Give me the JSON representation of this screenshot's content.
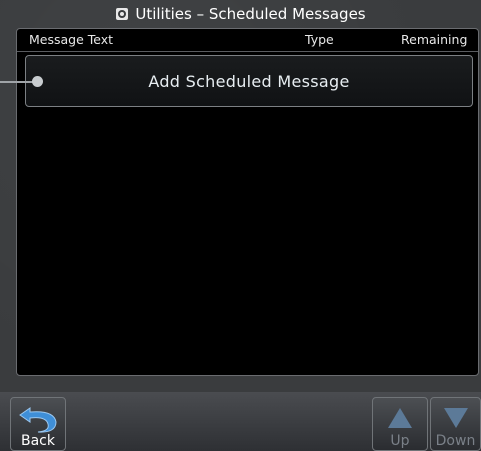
{
  "title": {
    "icon": "utilities-icon",
    "text": "Utilities – Scheduled Messages"
  },
  "table": {
    "columns": [
      "Message Text",
      "Type",
      "Remaining"
    ]
  },
  "add_button": {
    "label": "Add Scheduled Message"
  },
  "soft_keys": {
    "back": {
      "label": "Back",
      "icon": "back-arrow-icon"
    },
    "up": {
      "label": "Up",
      "icon": "up-arrow-icon"
    },
    "down": {
      "label": "Down",
      "icon": "down-arrow-icon"
    }
  },
  "colors": {
    "screen_background": "#3a3c3e",
    "panel_background": "#000000",
    "accent_blue": "#3f8fd8",
    "disabled_arrow": "#5c7a98"
  }
}
